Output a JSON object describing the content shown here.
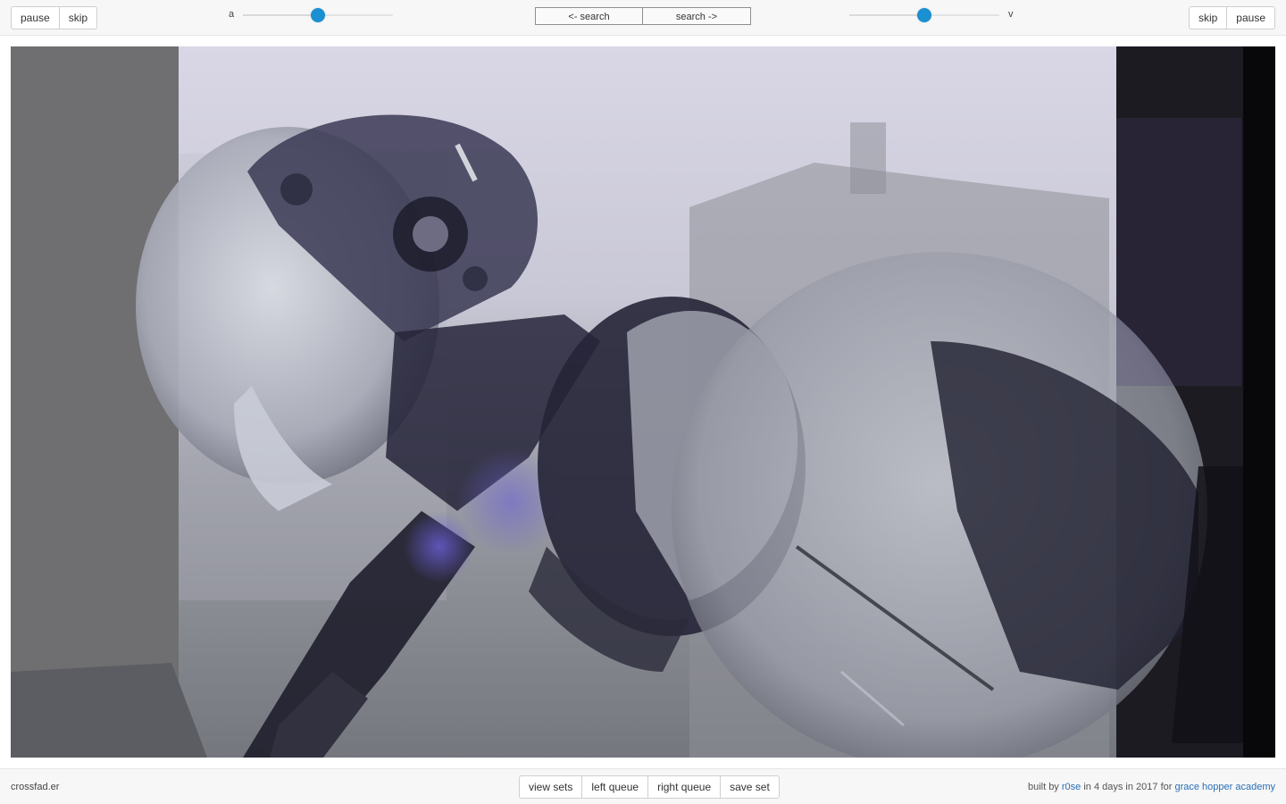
{
  "left_controls": {
    "pause_label": "pause",
    "skip_label": "skip"
  },
  "right_controls": {
    "skip_label": "skip",
    "pause_label": "pause"
  },
  "audio_slider": {
    "label": "a",
    "value": 0.5
  },
  "video_slider": {
    "label": "v",
    "value": 0.5
  },
  "search": {
    "back_label": "<- search",
    "forward_label": "search ->"
  },
  "footer": {
    "brand": "crossfad.er",
    "buttons": {
      "view_sets": "view sets",
      "left_queue": "left queue",
      "right_queue": "right queue",
      "save_set": "save set"
    },
    "credits": {
      "prefix": "built by",
      "author": "r0se",
      "middle": "in 4 days in 2017 for",
      "org": "grace hopper academy"
    }
  },
  "colors": {
    "accent": "#1a8fd1",
    "link": "#2a6fb5"
  }
}
